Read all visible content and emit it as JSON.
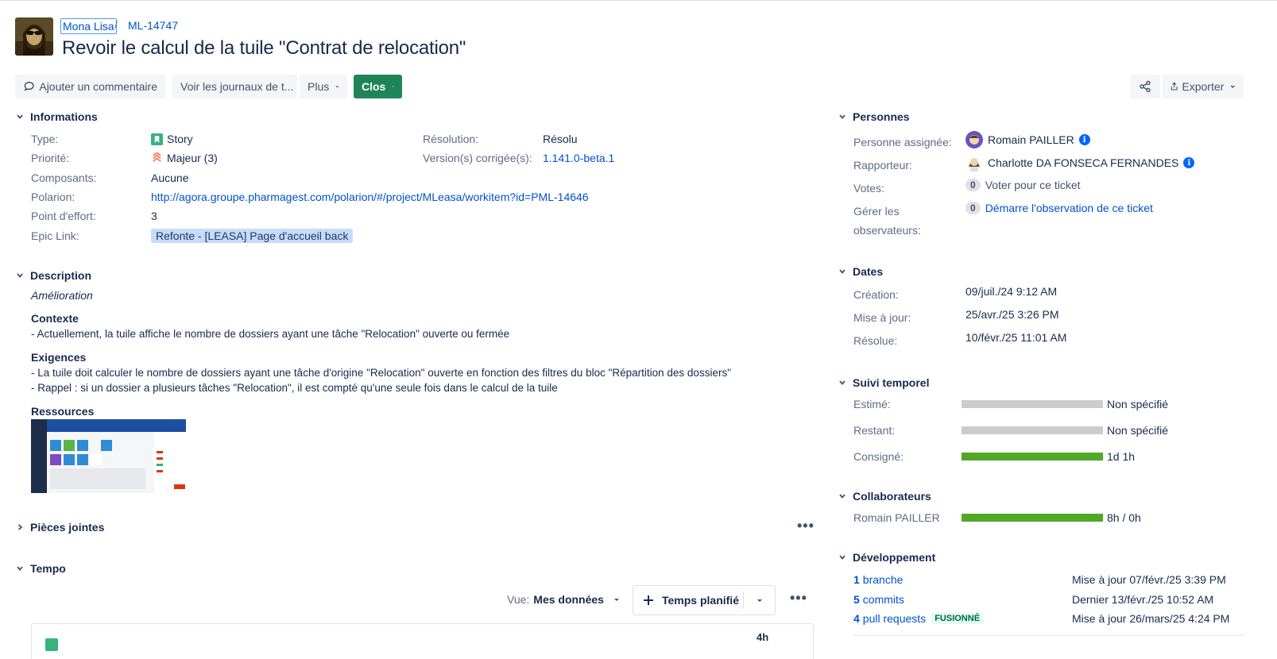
{
  "breadcrumb": {
    "project": "Mona Lisa",
    "separator": "/",
    "key": "ML-14747"
  },
  "issue": {
    "title": "Revoir le calcul de la tuile \"Contrat de relocation\""
  },
  "toolbar": {
    "comment_label": "Ajouter un commentaire",
    "logs_label": "Voir les journaux de t...",
    "more_label": "Plus",
    "status_label": "Clos",
    "export_label": "Exporter"
  },
  "info": {
    "heading": "Informations",
    "type_label": "Type:",
    "type_value": "Story",
    "priority_label": "Priorité:",
    "priority_value": "Majeur (3)",
    "components_label": "Composants:",
    "components_value": "Aucune",
    "polarion_label": "Polarion:",
    "polarion_value": "http://agora.groupe.pharmagest.com/polarion/#/project/MLeasa/workitem?id=PML-14646",
    "effort_label": "Point d'effort:",
    "effort_value": "3",
    "epic_label": "Epic Link:",
    "epic_value": "Refonte - [LEASA] Page d'accueil back",
    "resolution_label": "Résolution:",
    "resolution_value": "Résolu",
    "fixversion_label": "Version(s) corrigée(s):",
    "fixversion_value": "1.141.0-beta.1"
  },
  "description": {
    "heading": "Description",
    "subtitle": "Amélioration",
    "context_title": "Contexte",
    "context_line": "- Actuellement, la tuile affiche le nombre de dossiers ayant une tâche \"Relocation\" ouverte ou fermée",
    "req_title": "Exigences",
    "req_line1": "- La tuile doit calculer le nombre de dossiers ayant une tâche d'origine \"Relocation\" ouverte en fonction des filtres du bloc \"Répartition des dossiers\"",
    "req_line2": "- Rappel : si un dossier a plusieurs tâches \"Relocation\", il est compté qu'une seule fois dans le calcul de la tuile",
    "res_title": "Ressources"
  },
  "attachments": {
    "heading": "Pièces jointes"
  },
  "tempo": {
    "heading": "Tempo",
    "view_label": "Vue:",
    "view_value": "Mes données",
    "planned_label": "Temps planifié",
    "row_hours": "4h"
  },
  "people": {
    "heading": "Personnes",
    "assignee_label": "Personne assignée:",
    "assignee_value": "Romain PAILLER",
    "reporter_label": "Rapporteur:",
    "reporter_value": "Charlotte DA FONSECA FERNANDES",
    "votes_label": "Votes:",
    "votes_count": "0",
    "votes_text": "Voter pour ce ticket",
    "watchers_label_1": "Gérer les",
    "watchers_label_2": "observateurs:",
    "watchers_count": "0",
    "watchers_text": "Démarre l'observation de ce ticket"
  },
  "dates": {
    "heading": "Dates",
    "created_label": "Création:",
    "created_value": "09/juil./24 9:12 AM",
    "updated_label": "Mise à jour:",
    "updated_value": "25/avr./25 3:26 PM",
    "resolved_label": "Résolue:",
    "resolved_value": "10/févr./25 11:01 AM"
  },
  "time_tracking": {
    "heading": "Suivi temporel",
    "estimated_label": "Estimé:",
    "estimated_value": "Non spécifié",
    "remaining_label": "Restant:",
    "remaining_value": "Non spécifié",
    "logged_label": "Consigné:",
    "logged_value": "1d 1h",
    "logged_fraction": 1.0
  },
  "collaborators": {
    "heading": "Collaborateurs",
    "name": "Romain PAILLER",
    "value": "8h / 0h",
    "fraction": 1.0
  },
  "development": {
    "heading": "Développement",
    "branch_count": "1",
    "branch_label": "branche",
    "branch_meta": "Mise à jour 07/févr./25 3:39 PM",
    "commits_count": "5",
    "commits_label": "commits",
    "commits_meta": "Dernier 13/févr./25 10:52 AM",
    "pr_count": "4",
    "pr_label": "pull requests",
    "pr_badge": "FUSIONNÉ",
    "pr_meta": "Mise à jour 26/mars/25 4:24 PM"
  },
  "colors": {
    "link": "#0052cc",
    "status_green": "#1f845a",
    "bar_green": "#51a825"
  }
}
